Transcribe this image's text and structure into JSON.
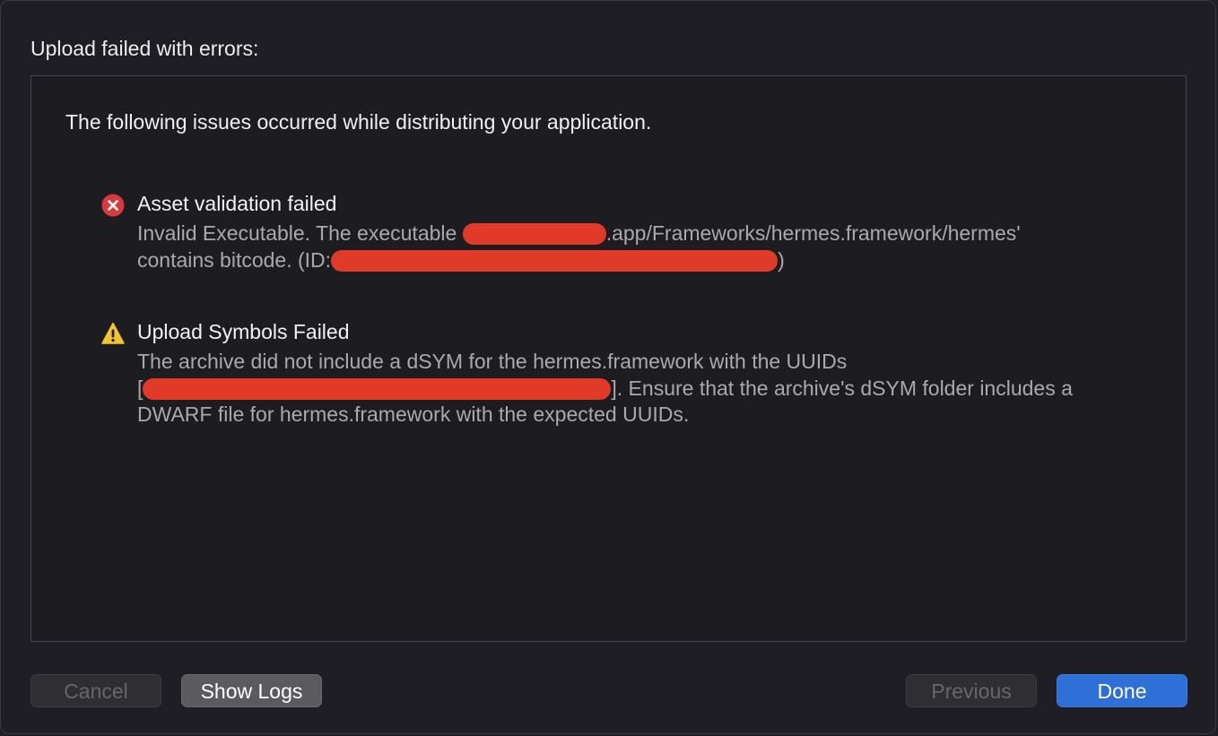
{
  "dialog": {
    "title": "Upload failed with errors:",
    "intro": "The following issues occurred while distributing your application."
  },
  "issues": [
    {
      "icon": "error-icon",
      "title": "Asset validation failed",
      "line1_prefix": "Invalid Executable. The executable",
      "line1_suffix": ".app/Frameworks/hermes.framework/hermes'",
      "line2_prefix": "contains bitcode. (ID:",
      "line2_suffix": ")"
    },
    {
      "icon": "warning-icon",
      "title": "Upload Symbols Failed",
      "line1": "The archive did not include a dSYM for the hermes.framework with the UUIDs",
      "line2_prefix": "[",
      "line2_suffix": "]. Ensure that the archive's dSYM folder includes a",
      "line3": "DWARF file for hermes.framework with the expected UUIDs."
    }
  ],
  "buttons": {
    "cancel": "Cancel",
    "show_logs": "Show Logs",
    "previous": "Previous",
    "done": "Done"
  },
  "colors": {
    "background": "#1e1e24",
    "error": "#d83b3b",
    "warning": "#f5c42c",
    "primary": "#2f6fd8",
    "redaction": "#e23a28"
  }
}
